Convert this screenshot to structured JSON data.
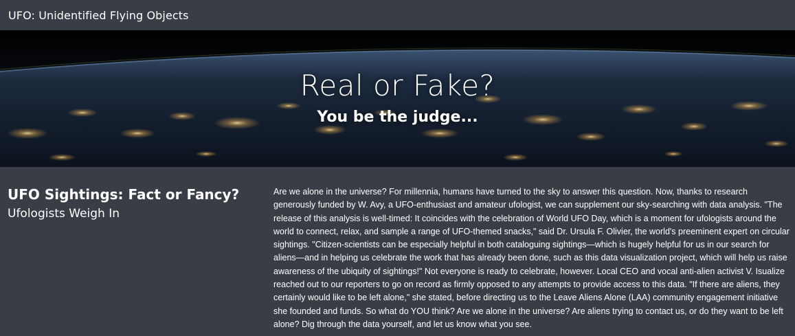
{
  "navbar": {
    "brand": "UFO: Unidentified Flying Objects"
  },
  "hero": {
    "title": "Real or Fake?",
    "subtitle": "You be the judge..."
  },
  "article": {
    "title": "UFO Sightings: Fact or Fancy?",
    "subtitle": "Ufologists Weigh In",
    "body": "Are we alone in the universe? For millennia, humans have turned to the sky to answer this question. Now, thanks to research generously funded by W. Avy, a UFO-enthusiast and amateur ufologist, we can supplement our sky-searching with data analysis. \"The release of this analysis is well-timed: It coincides with the celebration of World UFO Day, which is a moment for ufologists around the world to connect, relax, and sample a range of UFO-themed snacks,\" said Dr. Ursula F. Olivier, the world's preeminent expert on circular sightings. \"Citizen-scientists can be especially helpful in both cataloguing sightings—which is hugely helpful for us in our search for aliens—and in helping us celebrate the work that has already been done, such as this data visualization project, which will help us raise awareness of the ubiquity of sightings!\" Not everyone is ready to celebrate, however. Local CEO and vocal anti-alien activist V. Isualize reached out to our reporters to go on record as firmly opposed to any attempts to provide access to this data. \"If there are aliens, they certainly would like to be left alone,\" she stated, before directing us to the Leave Aliens Alone (LAA) community engagement initiative she founded and funds. So what do YOU think? Are we alone in the universe? Are aliens trying to contact us, or do they want to be left alone? Dig through the data yourself, and let us know what you see."
  },
  "colors": {
    "background": "#393e46",
    "text": "#ffffff"
  }
}
